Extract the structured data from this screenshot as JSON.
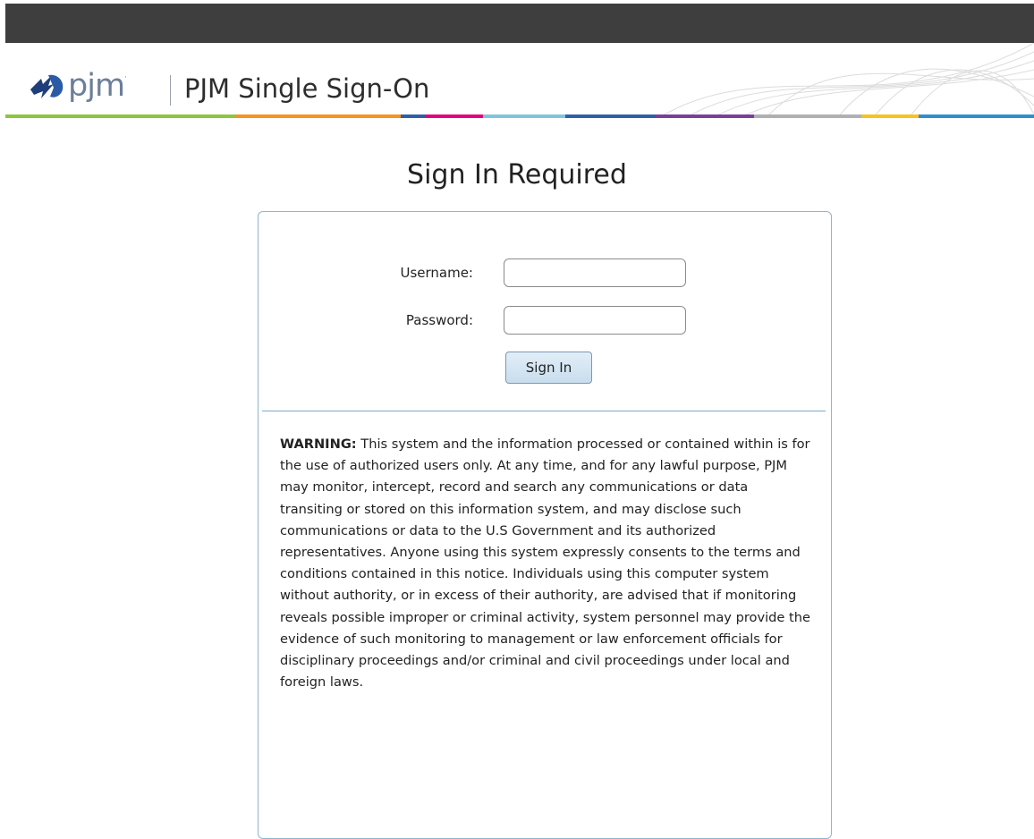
{
  "header": {
    "logo_text": "pjm",
    "logo_tm": "·",
    "app_title": "PJM Single Sign-On",
    "strip_colors": [
      "#8cc63f",
      "#8cc63f",
      "#f7941d",
      "#2e5fa8",
      "#e4007c",
      "#7fc6dc",
      "#2e5fa8",
      "#7b3f98",
      "#b0b0b0",
      "#f7c31d",
      "#2e8fd0"
    ]
  },
  "main": {
    "heading": "Sign In Required",
    "form": {
      "username_label": "Username:",
      "username_value": "",
      "password_label": "Password:",
      "password_value": "",
      "signin_label": "Sign In"
    },
    "warning": {
      "lead": "WARNING:",
      "body": "This system and the information processed or contained within is for the use of authorized users only. At any time, and for any lawful purpose, PJM may monitor, intercept, record and search any communications or data transiting or stored on this information system, and may disclose such communications or data to the U.S Government and its authorized representatives. Anyone using this system expressly consents to the terms and conditions contained in this notice. Individuals using this computer system without authority, or in excess of their authority, are advised that if monitoring reveals possible improper or criminal activity, system personnel may provide the evidence of such monitoring to management or law enforcement officials for disciplinary proceedings and/or criminal and civil proceedings under local and foreign laws."
    }
  }
}
